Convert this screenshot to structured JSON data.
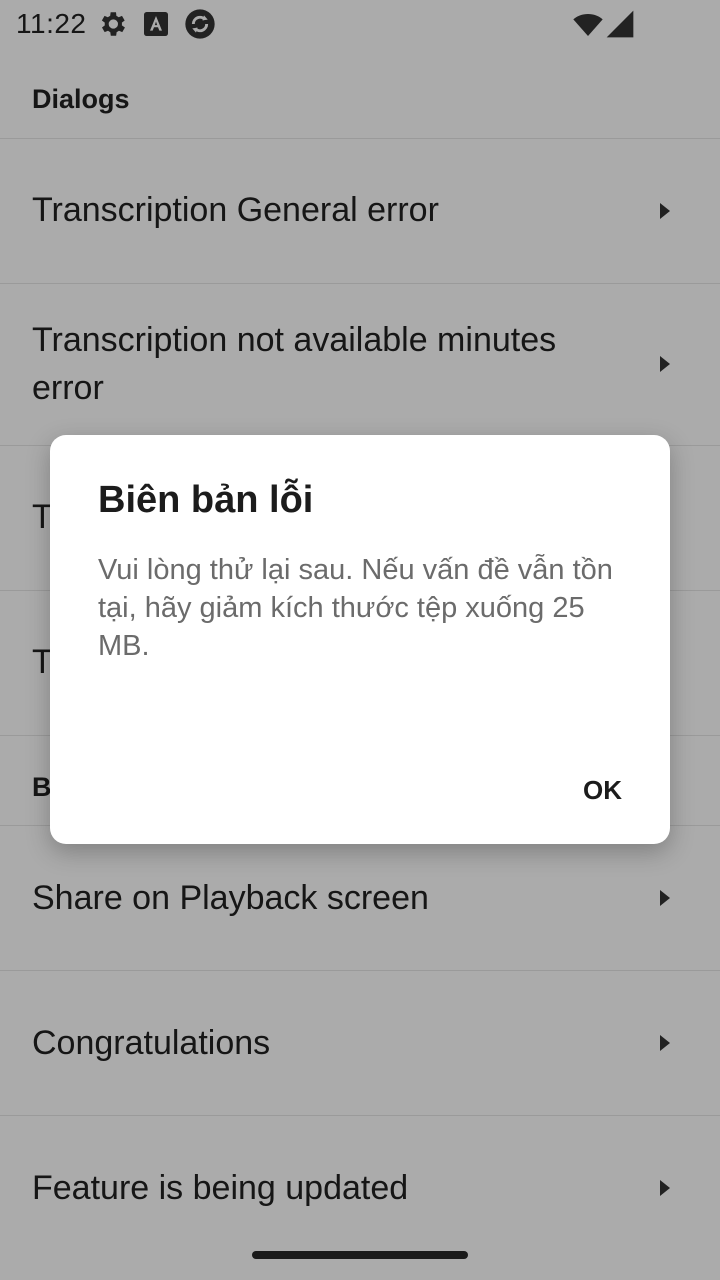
{
  "status_bar": {
    "time": "11:22",
    "icons": [
      "gear-icon",
      "a-font-icon",
      "sync-icon",
      "wifi-icon",
      "signal-icon"
    ]
  },
  "list": {
    "section_1": "Dialogs",
    "items_1": [
      "Transcription General error",
      "Transcription not available minutes error",
      "T",
      "T"
    ],
    "section_2": "B",
    "items_2": [
      "Share on Playback screen",
      "Congratulations",
      "Feature is being updated"
    ]
  },
  "dialog": {
    "title": "Biên bản lỗi",
    "message": "Vui lòng thử lại sau. Nếu vấn đề vẫn tồn tại, hãy giảm kích thước tệp xuống 25 MB.",
    "ok_label": "OK"
  },
  "colors": {
    "scrim": "#000000",
    "dialog_background": "#ffffff",
    "message_text": "#6b6b6b"
  }
}
